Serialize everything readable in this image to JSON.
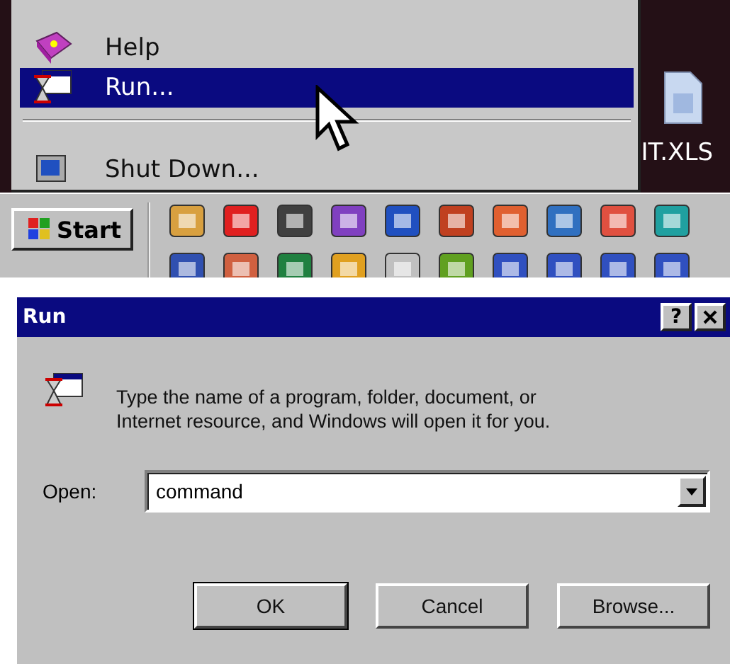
{
  "start_menu": {
    "items": [
      {
        "kind": "item",
        "label": "Help",
        "selected": false
      },
      {
        "kind": "item",
        "label": "Run...",
        "selected": true
      },
      {
        "kind": "separator"
      },
      {
        "kind": "item",
        "label": "Shut Down...",
        "selected": false
      }
    ]
  },
  "desktop": {
    "file_label": "IT.XLS"
  },
  "taskbar": {
    "start_button": "Start"
  },
  "dialog": {
    "title": "Run",
    "help_button": "?",
    "message": "Type the name of a program, folder, document, or Internet resource, and Windows will open it for you.",
    "open_label": "Open:",
    "open_value": "command",
    "buttons": [
      {
        "label": "OK",
        "default": true
      },
      {
        "label": "Cancel",
        "default": false
      },
      {
        "label": "Browse...",
        "default": false
      }
    ]
  }
}
